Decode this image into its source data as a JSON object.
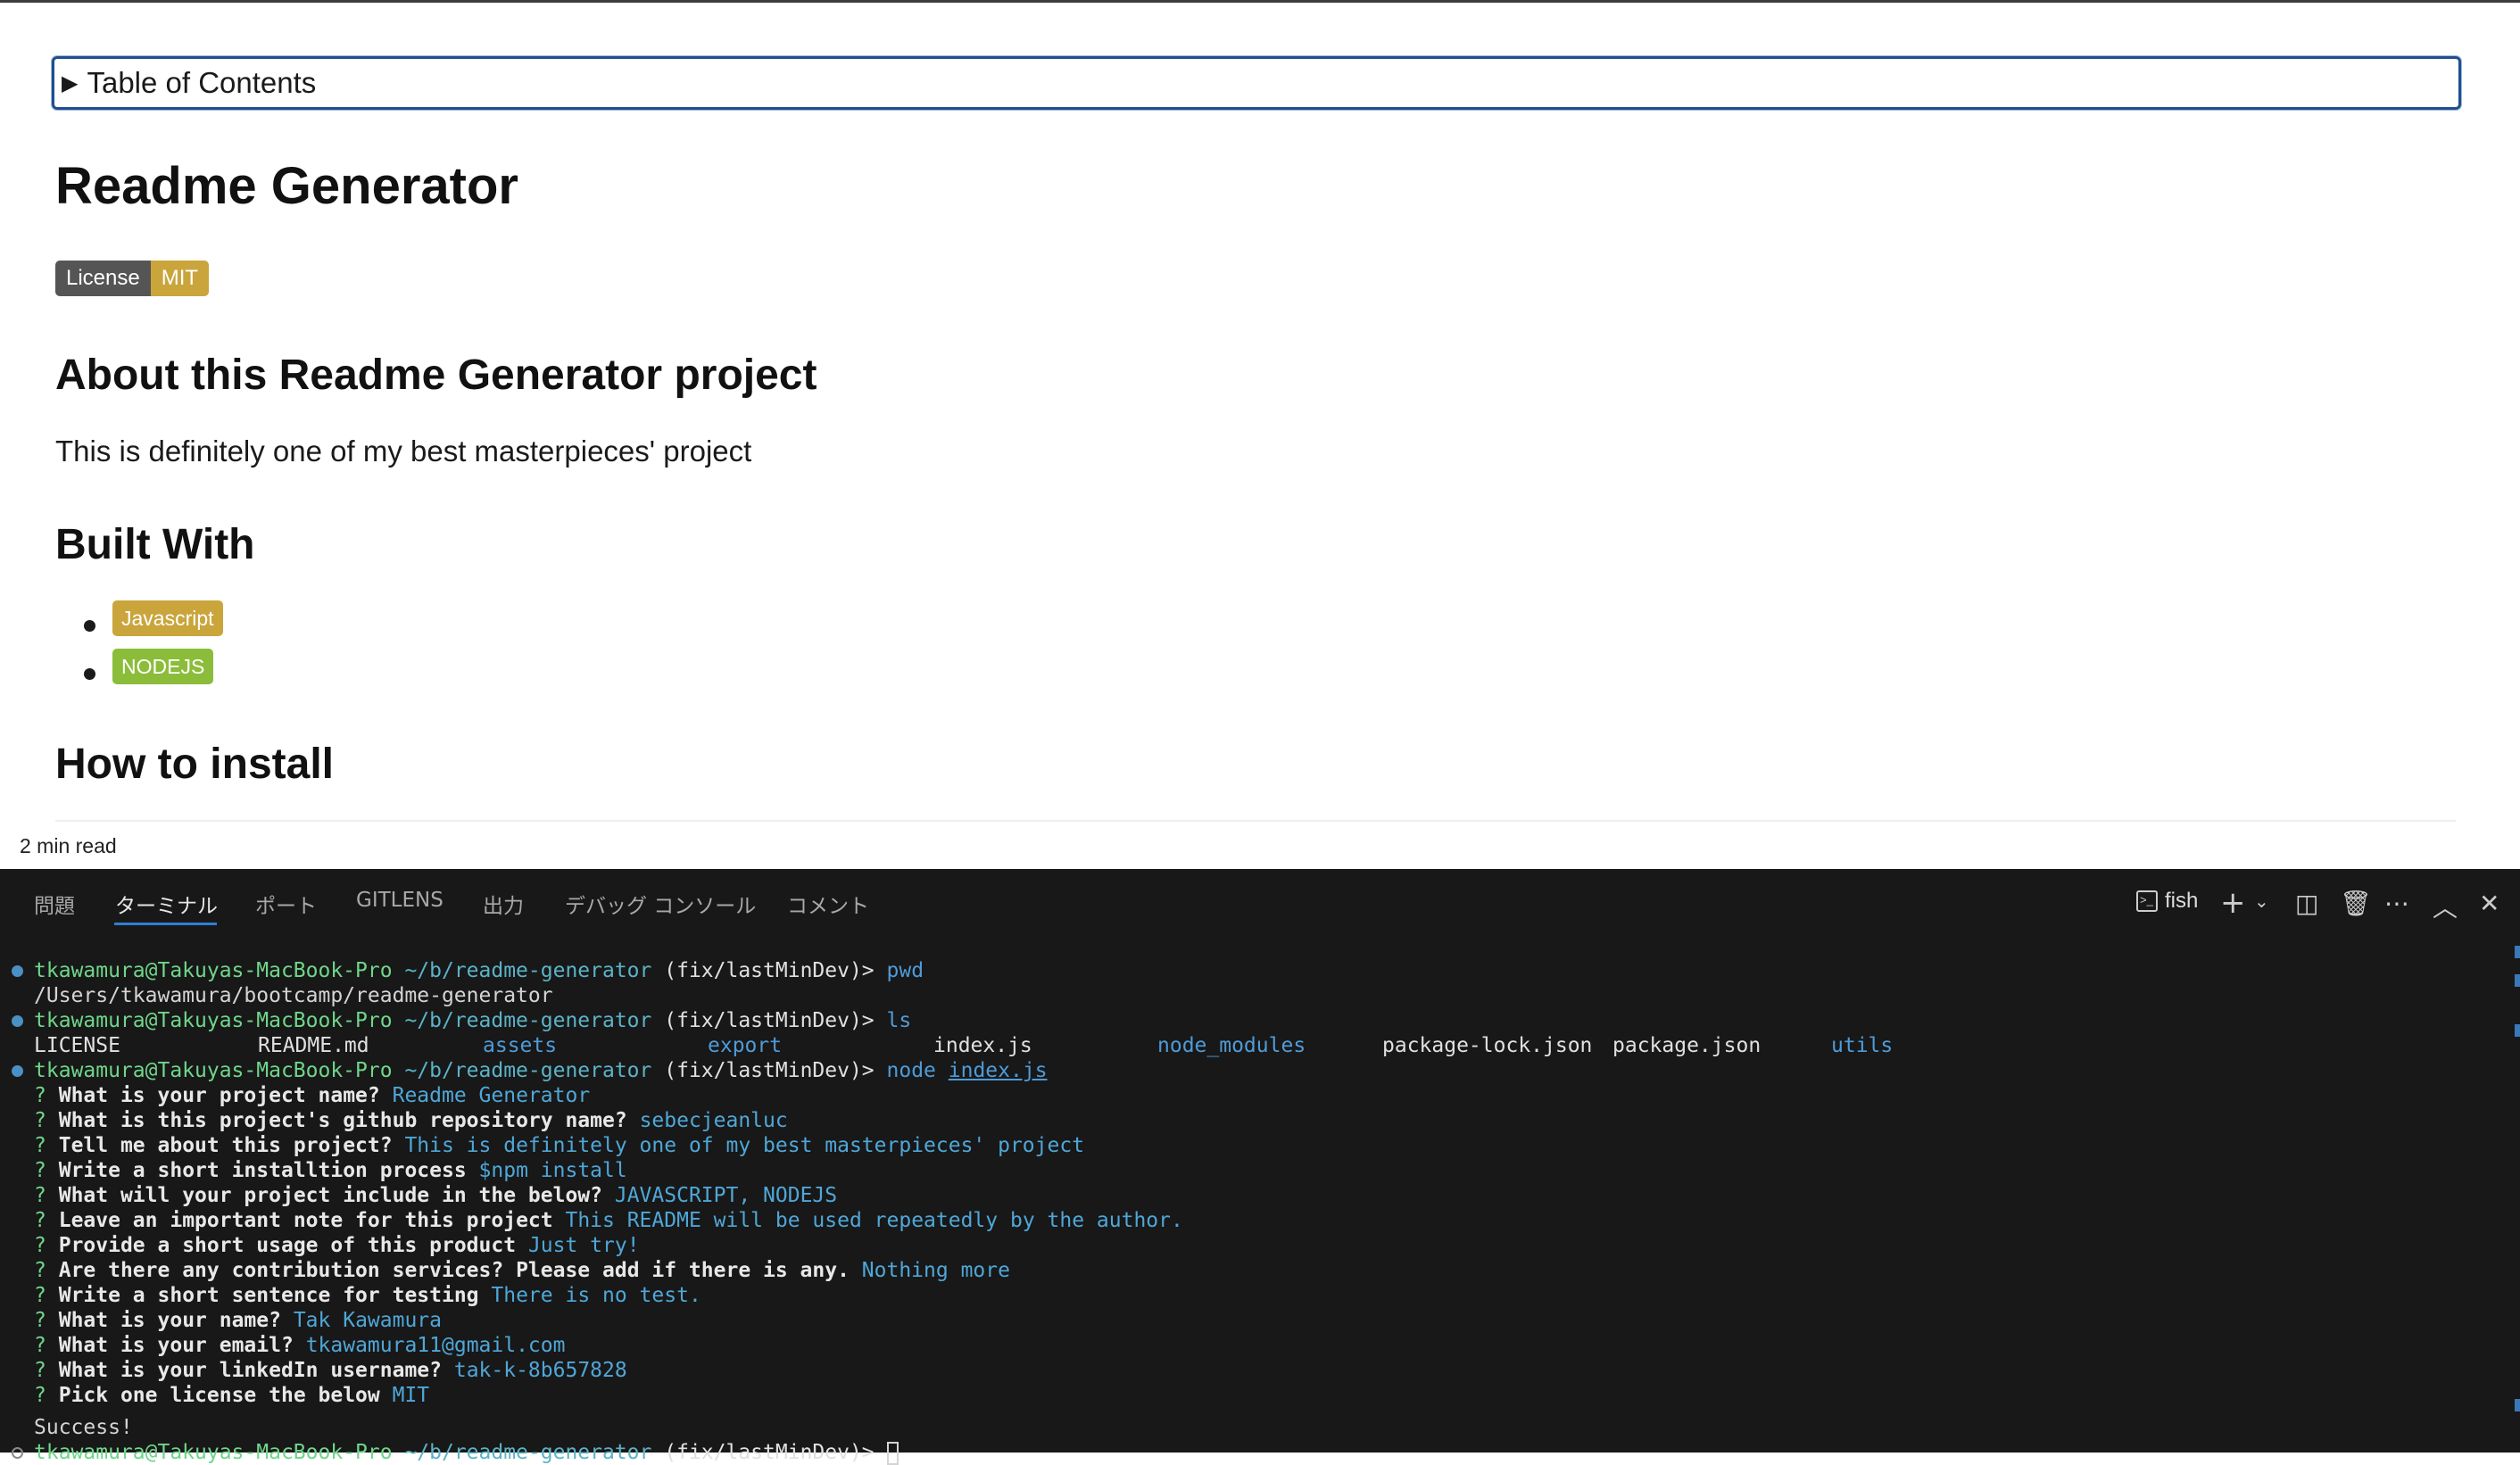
{
  "preview": {
    "toc_label": "Table of Contents",
    "title": "Readme Generator",
    "license_badge": {
      "left": "License",
      "right": "MIT"
    },
    "about_heading": "About this Readme Generator project",
    "about_text": "This is definitely one of my best masterpieces' project",
    "built_with_heading": "Built With",
    "built_with": [
      {
        "label": "Javascript",
        "color": "#c9a53c"
      },
      {
        "label": "NODEJS",
        "color": "#8bbd3a"
      }
    ],
    "install_heading": "How to install",
    "read_time": "2 min read"
  },
  "panel": {
    "tabs": [
      "問題",
      "ターミナル",
      "ポート",
      "GITLENS",
      "出力",
      "デバッグ コンソール",
      "コメント"
    ],
    "active_tab": "ターミナル",
    "terminal_name": "fish",
    "toolbar_icons": [
      "terminal-icon",
      "plus-icon",
      "chevron-down-icon",
      "split-icon",
      "trash-icon",
      "more-icon",
      "maximize-icon",
      "close-icon"
    ]
  },
  "terminal": {
    "user_host": "tkawamura@Takuyas-MacBook-Pro",
    "cwd": "~/b/readme-generator",
    "branch": "(fix/lastMinDev)>",
    "cmd1": "pwd",
    "pwd_output": "/Users/tkawamura/bootcamp/readme-generator",
    "cmd2": "ls",
    "ls_output": [
      "LICENSE",
      "README.md",
      "assets",
      "export",
      "index.js",
      "node_modules",
      "package-lock.json",
      "package.json",
      "utils"
    ],
    "cmd3_prefix": "node",
    "cmd3_arg": "index.js",
    "qa": [
      {
        "q": "What is your project name?",
        "a": "Readme Generator"
      },
      {
        "q": "What is this project's github repository name?",
        "a": "sebecjeanluc"
      },
      {
        "q": "Tell me about this project?",
        "a": "This is definitely one of my best masterpieces' project"
      },
      {
        "q": "Write a short installtion process",
        "a": "$npm install"
      },
      {
        "q": "What will your project include in the below?",
        "a": "JAVASCRIPT, NODEJS"
      },
      {
        "q": "Leave an important note for this project",
        "a": "This README will be used repeatedly by the author."
      },
      {
        "q": "Provide a short usage of this product",
        "a": "Just try!"
      },
      {
        "q": "Are there any contribution services? Please add if there is any.",
        "a": "Nothing more"
      },
      {
        "q": "Write a short sentence for testing",
        "a": "There is no test."
      },
      {
        "q": "What is your name?",
        "a": "Tak Kawamura"
      },
      {
        "q": "What is your email?",
        "a": "tkawamura11@gmail.com"
      },
      {
        "q": "What is your linkedIn username?",
        "a": "tak-k-8b657828"
      },
      {
        "q": "Pick one license the below",
        "a": "MIT"
      }
    ],
    "success": "Success!"
  }
}
